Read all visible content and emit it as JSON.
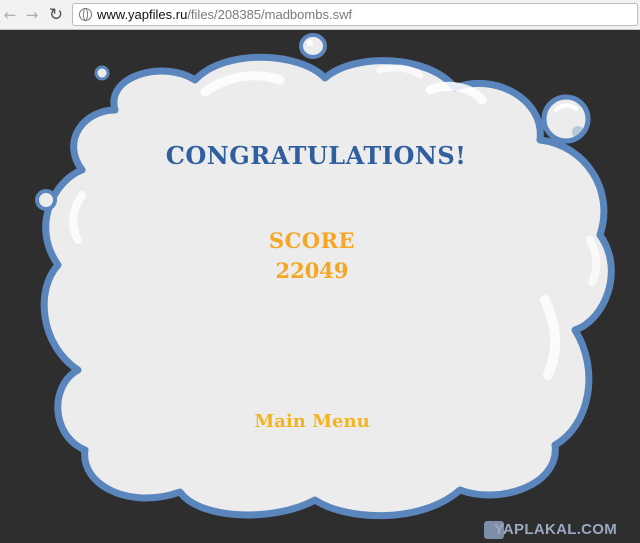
{
  "browser": {
    "url_host": "www.yapfiles.ru",
    "url_path": "/files/208385/madbombs.swf",
    "back_icon": "arrow-left-icon",
    "forward_icon": "arrow-right-icon",
    "reload_icon": "reload-icon"
  },
  "game": {
    "title": "CONGRATULATIONS!",
    "score_label": "SCORE",
    "score_value": "22049",
    "menu_label": "Main Menu"
  },
  "watermark": {
    "text": "YAPLAKAL.COM"
  },
  "colors": {
    "background": "#2e2e2e",
    "cloud_fill": "#ececec",
    "cloud_border": "#5a86bd",
    "title": "#2f5f9e",
    "score": "#f5a623",
    "menu": "#f2b51f"
  }
}
